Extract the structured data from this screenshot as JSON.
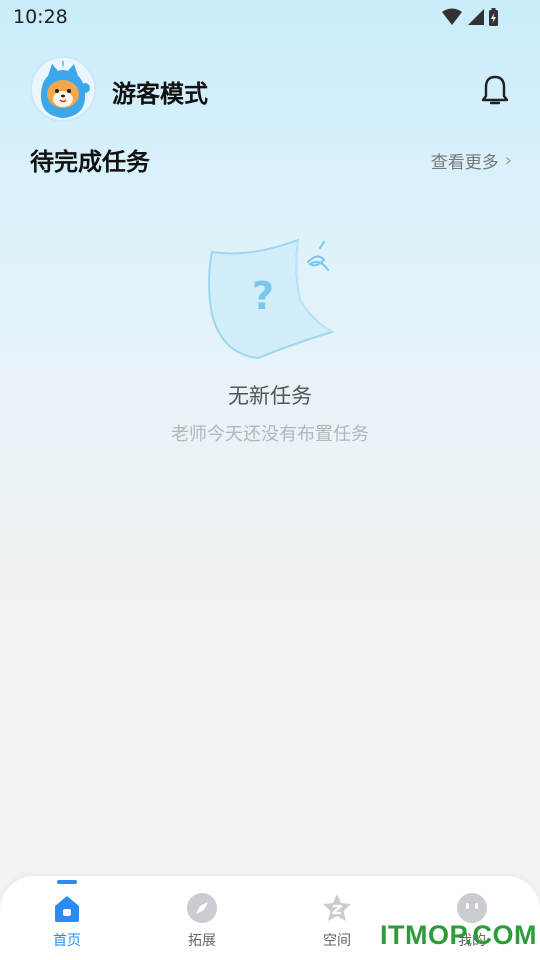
{
  "status_bar": {
    "time": "10:28",
    "icons": [
      "wifi-icon",
      "signal-icon",
      "battery-charging-icon"
    ]
  },
  "header": {
    "username": "游客模式",
    "avatar_icon": "shiba-mascot-avatar",
    "bell_icon": "bell-icon"
  },
  "tasks_section": {
    "title": "待完成任务",
    "more_label": "查看更多",
    "chevron": "›"
  },
  "empty_state": {
    "icon": "question-flag-icon",
    "title": "无新任务",
    "subtitle": "老师今天还没有布置任务"
  },
  "tabbar": {
    "accent_color": "#2a8cf0",
    "tabs": [
      {
        "label": "首页",
        "icon": "home-icon",
        "active": true
      },
      {
        "label": "拓展",
        "icon": "compass-icon",
        "active": false
      },
      {
        "label": "空间",
        "icon": "star-icon",
        "active": false
      },
      {
        "label": "我的",
        "icon": "face-icon",
        "active": false
      }
    ]
  },
  "watermark": {
    "text": "ITMOP.COM"
  }
}
